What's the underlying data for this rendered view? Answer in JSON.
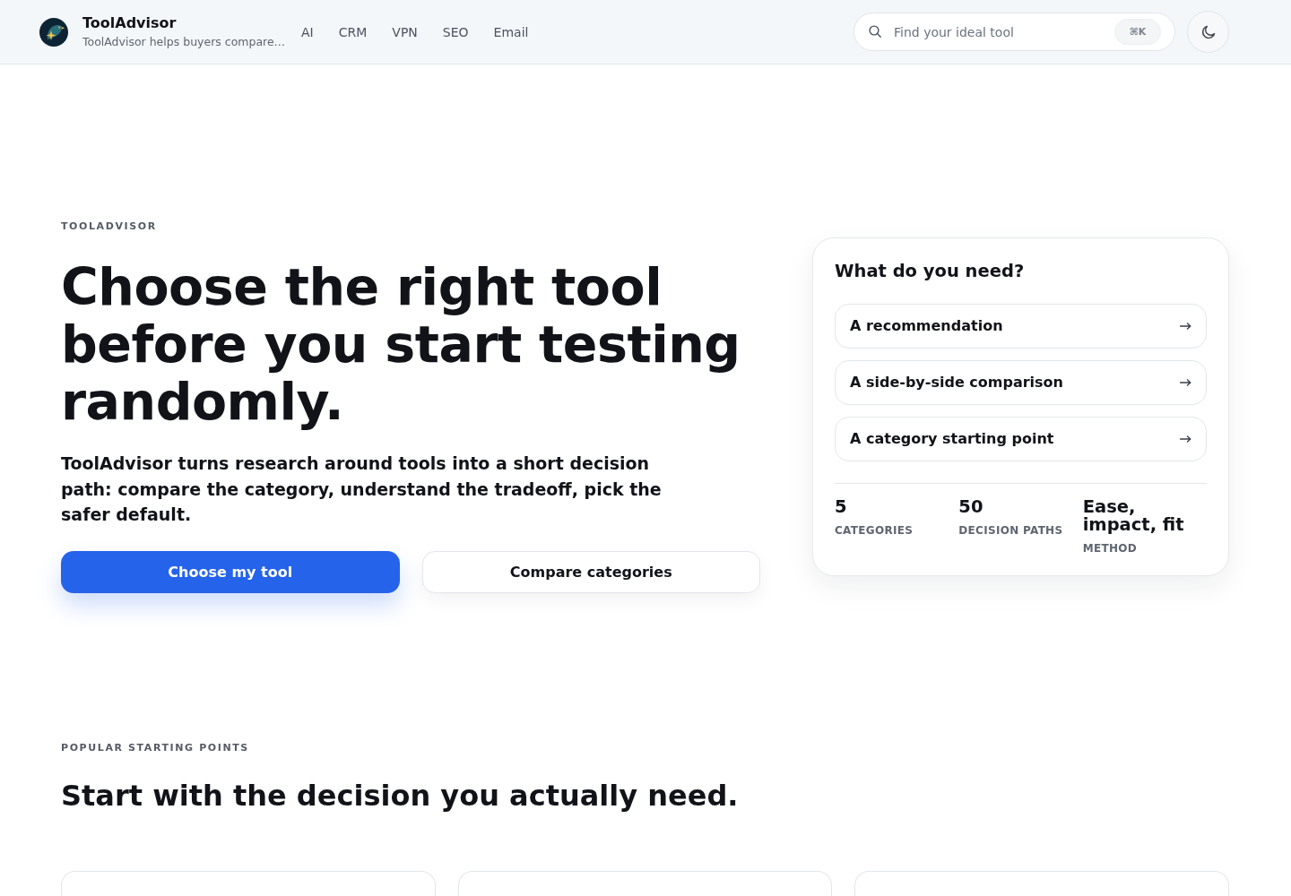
{
  "header": {
    "brand": {
      "name": "ToolAdvisor",
      "tagline": "ToolAdvisor helps buyers compare…"
    },
    "nav": [
      {
        "label": "AI"
      },
      {
        "label": "CRM"
      },
      {
        "label": "VPN"
      },
      {
        "label": "SEO"
      },
      {
        "label": "Email"
      }
    ],
    "search": {
      "placeholder": "Find your ideal tool",
      "shortcut": "⌘K"
    }
  },
  "hero": {
    "eyebrow": "TOOLADVISOR",
    "title": "Choose the right tool before you start testing randomly.",
    "lead": "ToolAdvisor turns research around tools into a short decision path: compare the category, understand the tradeoff, pick the safer default.",
    "buttons": [
      {
        "label": "Choose my tool",
        "kind": "primary"
      },
      {
        "label": "Compare categories",
        "kind": "secondary"
      }
    ]
  },
  "needs_panel": {
    "title": "What do you need?",
    "options": [
      {
        "label": "A recommendation"
      },
      {
        "label": "A side-by-side comparison"
      },
      {
        "label": "A category starting point"
      }
    ],
    "stats": [
      {
        "value": "5",
        "label": "CATEGORIES"
      },
      {
        "value": "50",
        "label": "DECISION PATHS"
      },
      {
        "value": "Ease, impact, fit",
        "label": "METHOD"
      }
    ]
  },
  "popular": {
    "eyebrow": "POPULAR STARTING POINTS",
    "title": "Start with the decision you actually need."
  }
}
